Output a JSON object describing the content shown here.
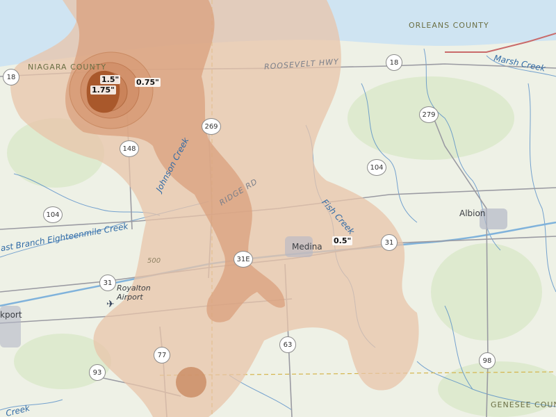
{
  "counties": {
    "niagara": "NIAGARA COUNTY",
    "orleans": "ORLEANS COUNTY",
    "genesee": "GENESEE COUNTY"
  },
  "roads": {
    "roosevelt": "ROOSEVELT HWY",
    "ridge": "RIDGE RD"
  },
  "waterways": {
    "marsh_creek": "Marsh Creek",
    "johnson_creek": "Johnson Creek",
    "fish_creek": "Fish Creek",
    "east_branch": "East Branch Eighteenmile Creek",
    "creek_sw": "Creek"
  },
  "places": {
    "albion": "Albion",
    "medina": "Medina",
    "royalton_airport": "Royalton\nAirport",
    "lockport_partial": "kport"
  },
  "routes": {
    "r18_west": "18",
    "r18_east": "18",
    "r279": "279",
    "r269": "269",
    "r148": "148",
    "r104_east": "104",
    "r104_west": "104",
    "r31_east": "31",
    "r31_west": "31",
    "r31e": "31E",
    "r63": "63",
    "r77": "77",
    "r93": "93",
    "r98": "98"
  },
  "contour_labels": {
    "c150": "1.5\"",
    "c175": "1.75\"",
    "c075": "0.75\"",
    "c050": "0.5\""
  },
  "contour_note": "500",
  "colors": {
    "lake": "#cfe4f2",
    "land": "#eef1e6",
    "swath_light": "#e8c4aa",
    "swath_mid": "#d9a07d",
    "swath_dark": "#c0764a",
    "core": "#a9582b",
    "water_line": "#4a86c6",
    "road_line": "#9a9aa2",
    "county_line": "#d4b44a"
  }
}
